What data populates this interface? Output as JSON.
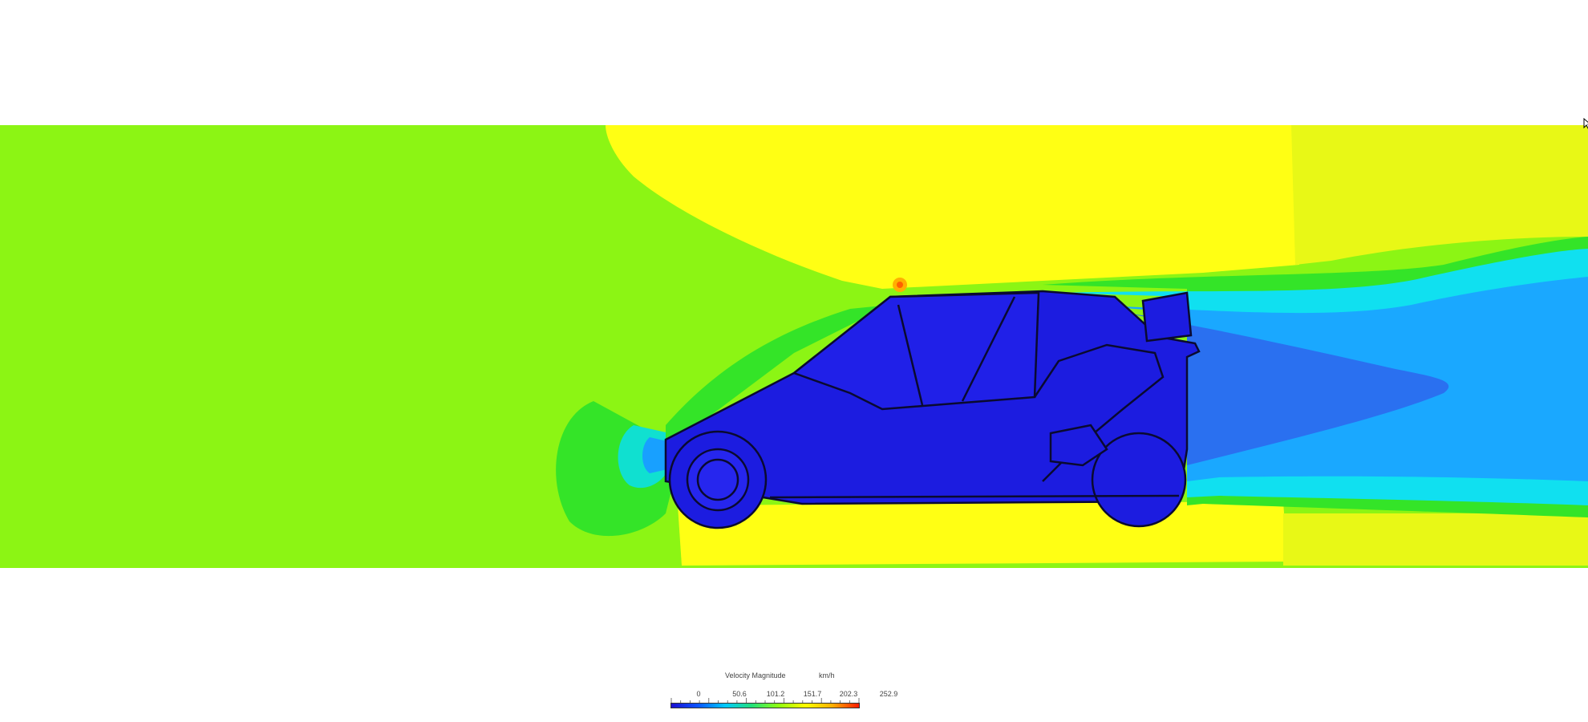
{
  "legend": {
    "title": "Velocity Magnitude",
    "unit": "km/h",
    "ticks": [
      "0",
      "50.6",
      "101.2",
      "151.7",
      "202.3",
      "252.9"
    ],
    "colormap": [
      "#1a0fd0",
      "#0a55ff",
      "#00c8ff",
      "#22e07a",
      "#8fff10",
      "#ffff00",
      "#ffb000",
      "#ff1a00"
    ]
  },
  "field": {
    "freestream_color": "#8cf514",
    "fast_color": "#ffff10",
    "slow_color": "#1c1ce0",
    "wake_color": "#10e0f0"
  },
  "icons": {
    "cursor": "mouse-pointer-icon"
  }
}
